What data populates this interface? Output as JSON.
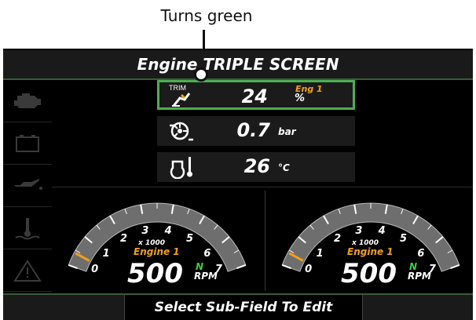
{
  "annotation": {
    "text": "Turns green"
  },
  "header": {
    "title": "Engine TRIPLE SCREEN"
  },
  "sidebar": {
    "items": [
      {
        "icon": "check-engine-icon"
      },
      {
        "icon": "battery-icon"
      },
      {
        "icon": "oil-pressure-icon"
      },
      {
        "icon": "coolant-temperature-icon"
      },
      {
        "icon": "warning-icon"
      }
    ]
  },
  "fields": {
    "trim": {
      "label": "TRIM",
      "value": "24",
      "engine": "Eng 1",
      "unit": "%",
      "icon": "trim-icon"
    },
    "boost": {
      "value": "0.7",
      "unit": "bar",
      "icon": "turbo-boost-icon"
    },
    "temp": {
      "value": "26",
      "unit": "°C",
      "icon": "engine-temperature-icon"
    }
  },
  "gauges": [
    {
      "multiplier": "x 1000",
      "engine": "Engine 1",
      "rpm": "500",
      "gear": "N",
      "unit": "RPM",
      "ticks": [
        "0",
        "1",
        "2",
        "3",
        "4",
        "5",
        "6",
        "7"
      ]
    },
    {
      "multiplier": "x 1000",
      "engine": "Engine 1",
      "rpm": "500",
      "gear": "N",
      "unit": "RPM",
      "ticks": [
        "0",
        "1",
        "2",
        "3",
        "4",
        "5",
        "6",
        "7"
      ]
    }
  ],
  "footer": {
    "message": "Select Sub-Field To Edit"
  },
  "colors": {
    "accent_green": "#4caf50",
    "engine_orange": "#f2a01a",
    "gear_green": "#3bd13b"
  }
}
